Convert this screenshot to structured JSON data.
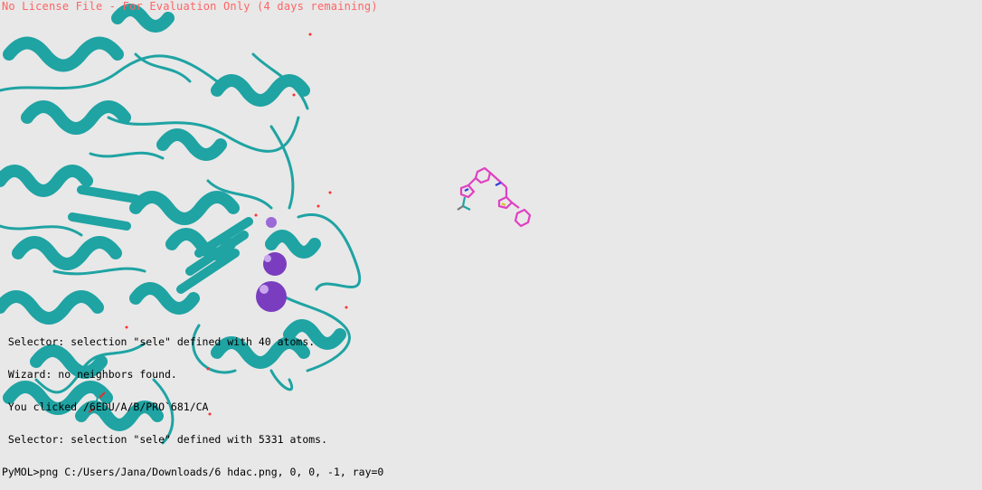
{
  "license_banner": "No License File - For Evaluation Only (4 days remaining)",
  "colors": {
    "background": "#e8e8e8",
    "protein_cartoon": "#1fa3a3",
    "ligand_carbon": "#e040c0",
    "metal_ion": "#7a3dbf",
    "water": "#ff3030",
    "banner_text": "#ff6464"
  },
  "console": {
    "lines": [
      " Selector: selection \"sele\" defined with 40 atoms.",
      " Wizard: no neighbors found.",
      " You clicked /6EDU/A/B/PRO`681/CA",
      " Selector: selection \"sele\" defined with 5331 atoms."
    ],
    "prompt_label": "PyMOL>",
    "command": "png C:/Users/Jana/Downloads/6 hdac.png, 0, 0, -1, ray=0"
  }
}
